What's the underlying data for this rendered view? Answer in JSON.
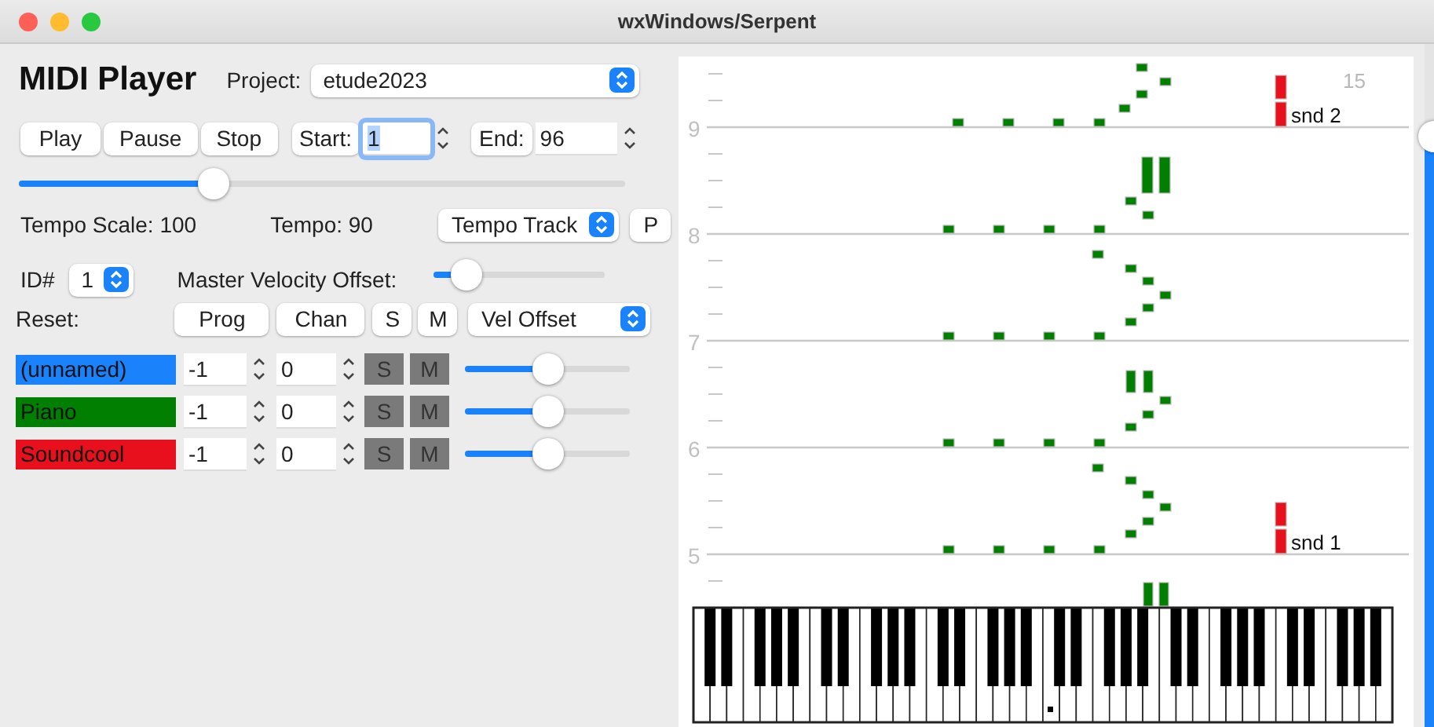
{
  "window": {
    "title": "wxWindows/Serpent"
  },
  "header": {
    "title": "MIDI Player",
    "project_label": "Project:",
    "project": "etude2023"
  },
  "transport": {
    "buttons": [
      "Play",
      "Pause",
      "Stop"
    ],
    "start_label": "Start:",
    "start": "1",
    "end_label": "End:",
    "end": "96"
  },
  "tempo_slider": {
    "level": 0.32
  },
  "tempo_scale": "Tempo Scale: 100",
  "tempo": "Tempo: 90",
  "tempo_source": "Tempo Track",
  "p_button": "P",
  "id_label": "ID#",
  "id": "1",
  "master_velocity_label": "Master Velocity Offset:",
  "master_velocity": {
    "level": 0.2
  },
  "reset_label": "Reset:",
  "reset_buttons": [
    "Prog",
    "Chan",
    "S",
    "M"
  ],
  "velocity_mode": "Vel Offset",
  "tracks": [
    {
      "name": "(unnamed)",
      "color": "#1a82fb",
      "program": "-1",
      "channel": "0",
      "solo": "S",
      "mute": "M",
      "level": 0.5
    },
    {
      "name": "Piano",
      "color": "#007f00",
      "program": "-1",
      "channel": "0",
      "solo": "S",
      "mute": "M",
      "level": 0.5
    },
    {
      "name": "Soundcool",
      "color": "#e8101c",
      "program": "-1",
      "channel": "0",
      "solo": "S",
      "mute": "M",
      "level": 0.5
    }
  ],
  "piano_roll": {
    "staff_labels": [
      "9",
      "8",
      "7",
      "6",
      "5"
    ],
    "corner_label": "15",
    "markers": [
      {
        "label": "snd 2"
      },
      {
        "label": "snd 1"
      }
    ]
  },
  "zoom_slider": {
    "level": 0.85
  }
}
